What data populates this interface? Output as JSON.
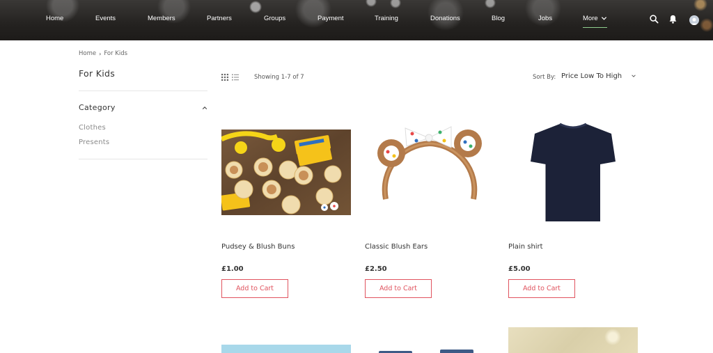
{
  "nav": {
    "items": [
      "Home",
      "Events",
      "Members",
      "Partners",
      "Groups",
      "Payment",
      "Training",
      "Donations",
      "Blog",
      "Jobs"
    ],
    "more_label": "More"
  },
  "breadcrumb": {
    "home": "Home",
    "separator": "›",
    "current": "For Kids"
  },
  "page_title": "For Kids",
  "sidebar": {
    "category_title": "Category",
    "categories": [
      "Clothes",
      "Presents"
    ]
  },
  "toolbar": {
    "showing": "Showing 1-7 of 7",
    "sort_label": "Sort By:",
    "sort_value": "Price Low To High"
  },
  "products": [
    {
      "name": "Pudsey & Blush Buns",
      "price": "£1.00",
      "button": "Add to Cart"
    },
    {
      "name": "Classic Blush Ears",
      "price": "£2.50",
      "button": "Add to Cart"
    },
    {
      "name": "Plain shirt",
      "price": "£5.00",
      "button": "Add to Cart"
    }
  ],
  "colors": {
    "accent": "#e0535e",
    "nav_active_underline": "#8fcf8f",
    "header_bg": "#242220"
  }
}
